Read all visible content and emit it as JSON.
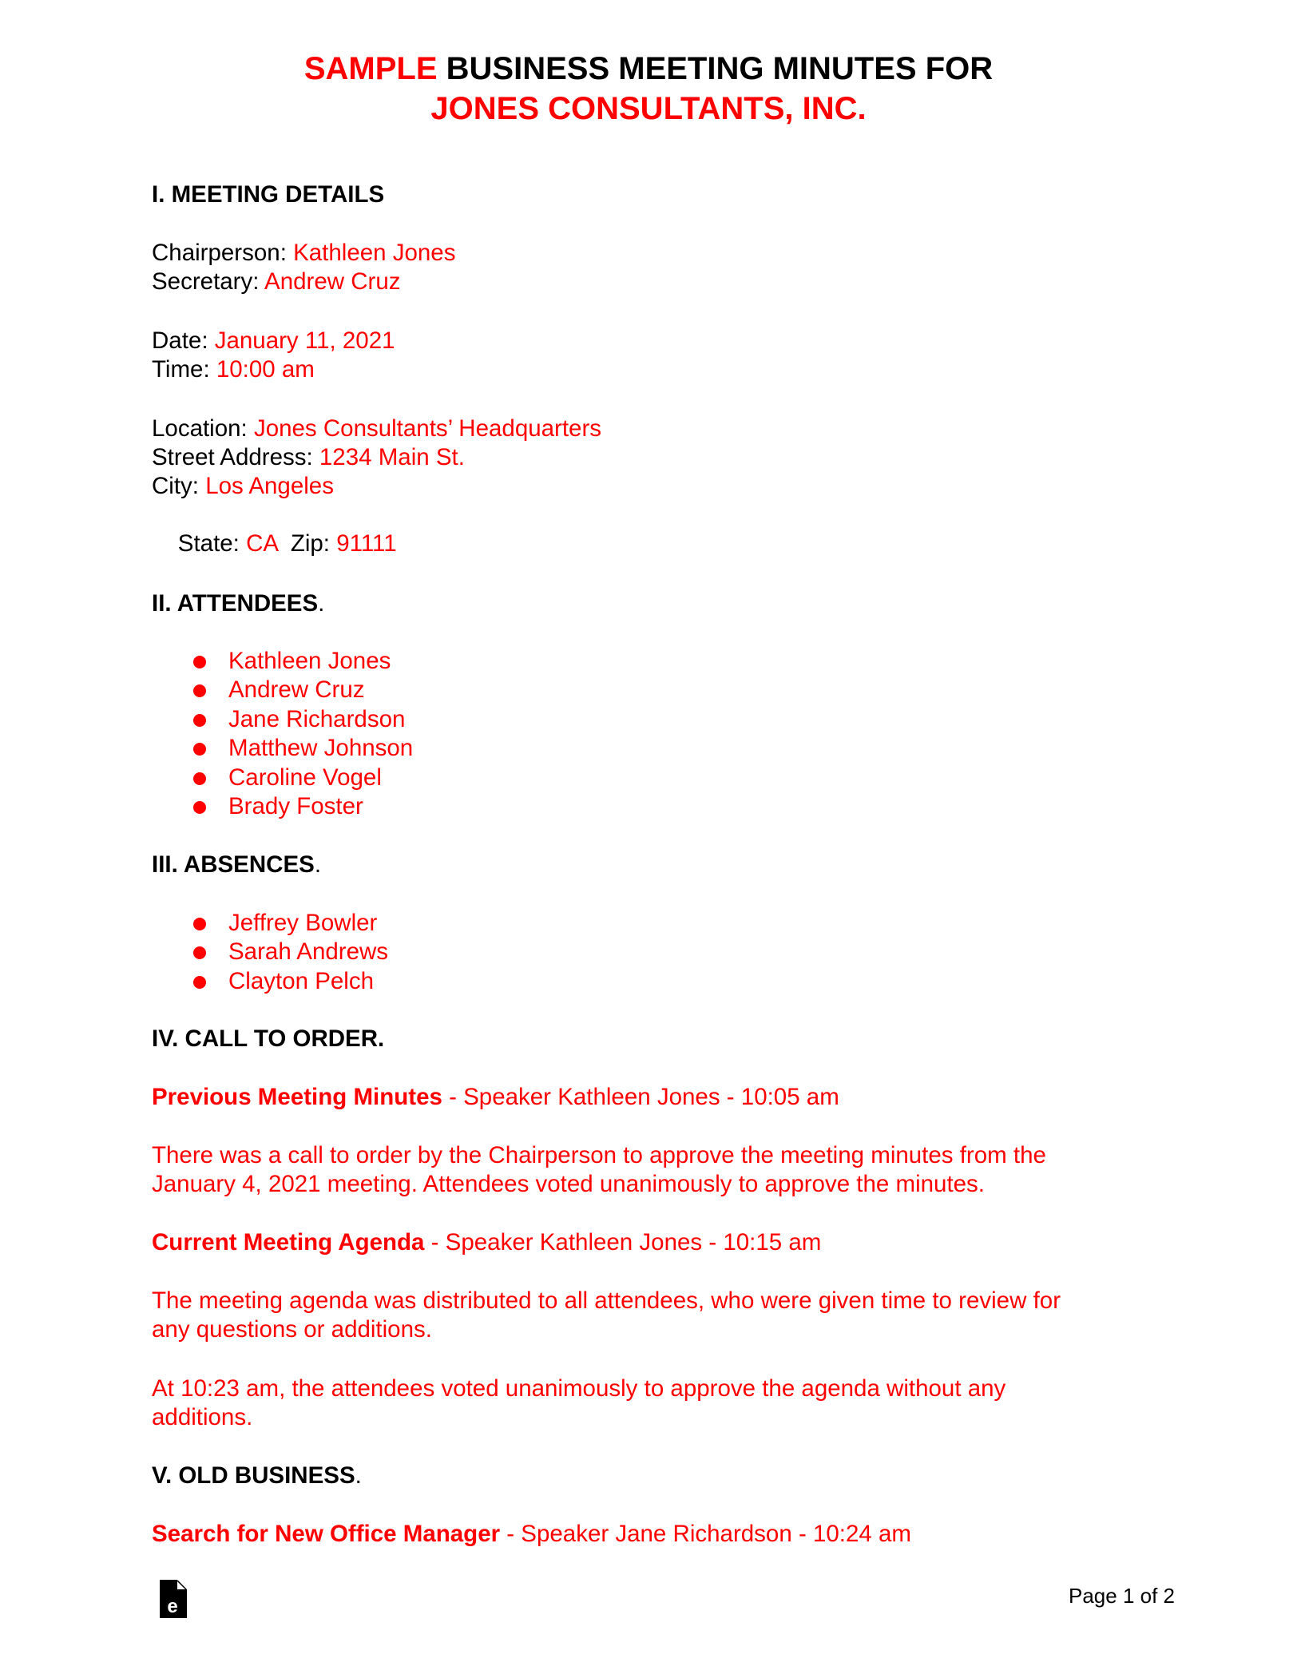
{
  "title": {
    "line1_highlight": "SAMPLE",
    "line1_rest": " BUSINESS MEETING MINUTES FOR",
    "line2": "JONES CONSULTANTS, INC."
  },
  "meeting_details": {
    "heading": "I. MEETING DETAILS",
    "fields": {
      "chairperson_label": "Chairperson: ",
      "chairperson_value": "Kathleen Jones",
      "secretary_label": "Secretary: ",
      "secretary_value": "Andrew Cruz",
      "date_label": "Date: ",
      "date_value": "January 11, 2021",
      "time_label": "Time: ",
      "time_value": "10:00 am",
      "location_label": "Location: ",
      "location_value": "Jones Consultants’ Headquarters",
      "street_label": "Street Address: ",
      "street_value": "1234 Main St.",
      "city_label": "City: ",
      "city_value": "Los Angeles",
      "state_label": "State: ",
      "state_value": "CA",
      "zip_label": "  Zip: ",
      "zip_value": "91111"
    }
  },
  "attendees": {
    "heading": "II. ATTENDEES",
    "heading_punct": ".",
    "items": [
      "Kathleen Jones",
      "Andrew Cruz",
      "Jane Richardson",
      "Matthew Johnson",
      "Caroline Vogel",
      "Brady Foster"
    ]
  },
  "absences": {
    "heading": "III. ABSENCES",
    "heading_punct": ".",
    "items": [
      "Jeffrey Bowler",
      "Sarah Andrews",
      "Clayton Pelch"
    ]
  },
  "call_to_order": {
    "heading": "IV. CALL TO ORDER.",
    "topics": [
      {
        "title": "Previous Meeting Minutes",
        "meta": " - Speaker Kathleen Jones - 10:05 am",
        "paragraphs": [
          [
            "There was a call to order by the Chairperson to approve the meeting minutes from the",
            "January 4, 2021 meeting. Attendees voted unanimously to approve the minutes."
          ]
        ]
      },
      {
        "title": "Current Meeting Agenda",
        "meta": " - Speaker Kathleen Jones - 10:15 am",
        "paragraphs": [
          [
            "The meeting agenda was distributed to all attendees, who were given time to review for",
            "any questions or additions."
          ],
          [
            "At 10:23 am, the attendees voted unanimously to approve the agenda without any",
            "additions."
          ]
        ]
      }
    ]
  },
  "old_business": {
    "heading": "V. OLD BUSINESS",
    "heading_punct": ".",
    "topics": [
      {
        "title": "Search for New Office Manager",
        "meta": " - Speaker Jane Richardson - 10:24 am"
      }
    ]
  },
  "footer": {
    "logo_icon": "document-e-icon",
    "page_label": "Page 1 of 2"
  },
  "colors": {
    "accent": "#ff0000",
    "text": "#000000"
  }
}
